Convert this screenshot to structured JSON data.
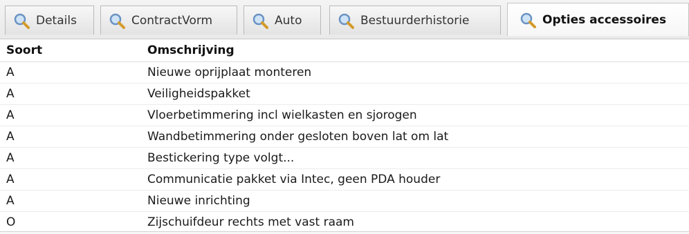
{
  "tabs": [
    {
      "label": "Details",
      "active": false
    },
    {
      "label": "ContractVorm",
      "active": false
    },
    {
      "label": "Auto",
      "active": false
    },
    {
      "label": "Bestuurderhistorie",
      "active": false
    },
    {
      "label": "Opties accessoires",
      "active": true
    }
  ],
  "tab_icon": "magnifier-icon",
  "table": {
    "columns": [
      "Soort",
      "Omschrijving"
    ],
    "rows": [
      [
        "A",
        "Nieuwe oprijplaat monteren"
      ],
      [
        "A",
        "Veiligheidspakket"
      ],
      [
        "A",
        "Vloerbetimmering incl wielkasten en sjorogen"
      ],
      [
        "A",
        "Wandbetimmering onder gesloten boven lat om lat"
      ],
      [
        "A",
        "Bestickering type volgt..."
      ],
      [
        "A",
        "Communicatie pakket via Intec, geen PDA houder"
      ],
      [
        "A",
        "Nieuwe inrichting"
      ],
      [
        "O",
        "Zijschuifdeur rechts met vast raam"
      ]
    ]
  }
}
